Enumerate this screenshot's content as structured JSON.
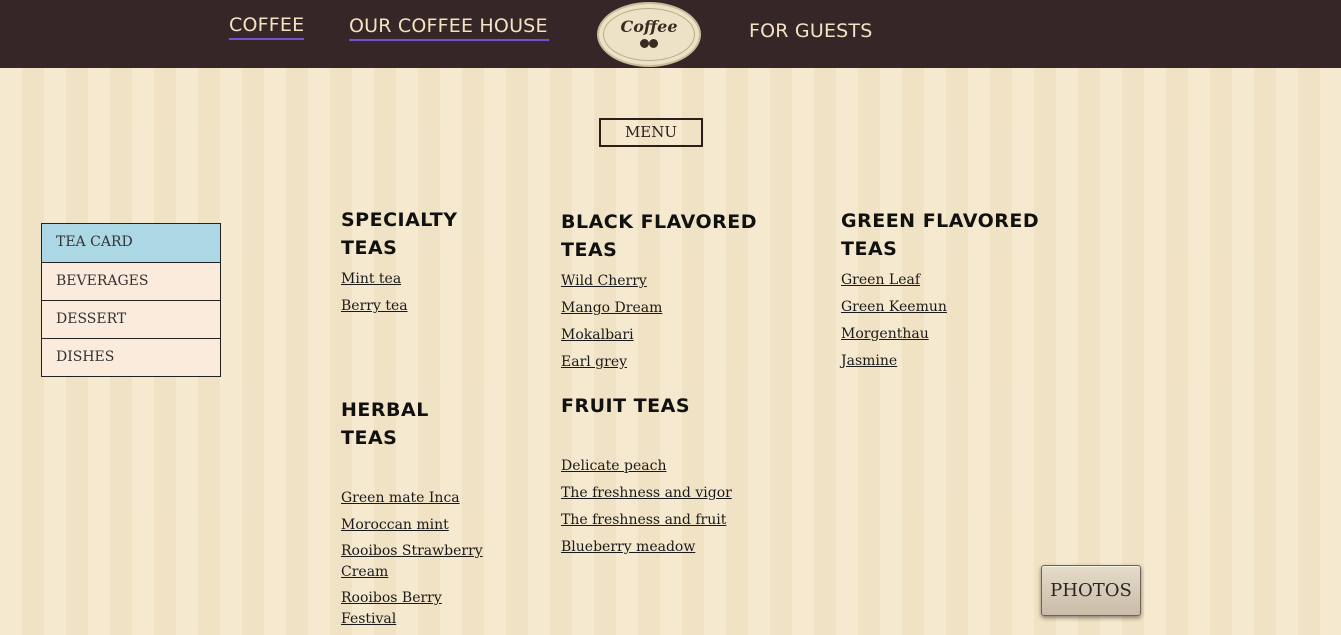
{
  "header": {
    "nav": [
      {
        "label": "COFFEE"
      },
      {
        "label": "OUR COFFEE HOUSE"
      },
      {
        "label": "FOR GUESTS"
      }
    ],
    "logo_text": "Coffee",
    "colors": {
      "bar": "#352727",
      "nav_text": "#f4e3c2",
      "underline": "#7a4fd0"
    }
  },
  "menu_button": {
    "label": "MENU"
  },
  "sidebar": {
    "items": [
      {
        "label": "TEA CARD",
        "active": true
      },
      {
        "label": "BEVERAGES"
      },
      {
        "label": "DESSERT"
      },
      {
        "label": "DISHES"
      }
    ],
    "colors": {
      "active_bg": "#acd8e6",
      "item_bg": "#faebdc"
    }
  },
  "tea_sections": {
    "specialty": {
      "title": "SPECIALTY TEAS",
      "items": [
        "Mint tea",
        "Berry tea"
      ]
    },
    "black": {
      "title": "BLACK FLAVORED TEAS",
      "items": [
        "Wild Cherry",
        "Mango Dream",
        "Mokalbari",
        "Earl grey"
      ]
    },
    "green": {
      "title": "GREEN FLAVORED TEAS",
      "items": [
        "Green Leaf",
        "Green Keemun",
        "Morgenthau",
        "Jasmine"
      ]
    },
    "herbal": {
      "title": "HERBAL TEAS",
      "items": [
        "Green mate Inca",
        "Moroccan mint",
        "Rooibos Strawberry Cream",
        "Rooibos Berry Festival"
      ]
    },
    "fruit": {
      "title": "FRUIT TEAS",
      "items": [
        "Delicate peach",
        "The freshness and vigor",
        "The freshness and fruit",
        "Blueberry meadow"
      ]
    }
  },
  "photos_button": {
    "label": "PHOTOS"
  }
}
